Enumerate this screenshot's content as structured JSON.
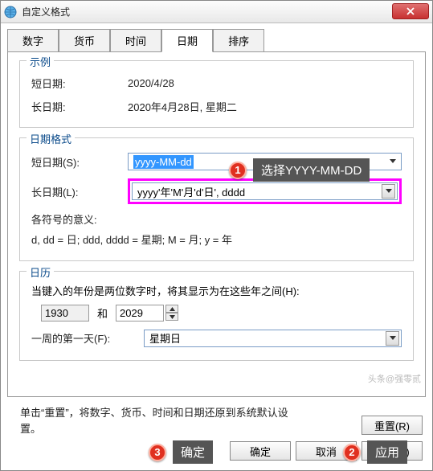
{
  "window": {
    "title": "自定义格式"
  },
  "tabs": {
    "items": [
      "数字",
      "货币",
      "时间",
      "日期",
      "排序"
    ],
    "active": 3
  },
  "example": {
    "legend": "示例",
    "short_label": "短日期:",
    "short_value": "2020/4/28",
    "long_label": "长日期:",
    "long_value": "2020年4月28日, 星期二"
  },
  "formats": {
    "legend": "日期格式",
    "short_label": "短日期(S):",
    "short_value": "yyyy-MM-dd",
    "long_label": "长日期(L):",
    "long_value": "yyyy'年'M'月'd'日', dddd",
    "meaning_label": "各符号的意义:",
    "meaning_text": "d, dd = 日;  ddd, dddd = 星期;  M = 月;  y = 年"
  },
  "calendar": {
    "legend": "日历",
    "two_digit_label": "当键入的年份是两位数字时，将其显示为在这些年之间(H):",
    "from": "1930",
    "and": "和",
    "to": "2029",
    "first_day_label": "一周的第一天(F):",
    "first_day_value": "星期日"
  },
  "footer": {
    "hint": "单击“重置”，将数字、货币、时间和日期还原到系统默认设置。"
  },
  "buttons": {
    "reset": "重置(R)",
    "ok": "确定",
    "cancel": "取消",
    "apply": "应用(A)"
  },
  "annotations": {
    "a1": {
      "num": "1",
      "text": "选择YYYY-MM-DD"
    },
    "a2": {
      "num": "2",
      "text": "应用"
    },
    "a3": {
      "num": "3",
      "text": "确定"
    }
  },
  "watermark": "头条@强零贰"
}
